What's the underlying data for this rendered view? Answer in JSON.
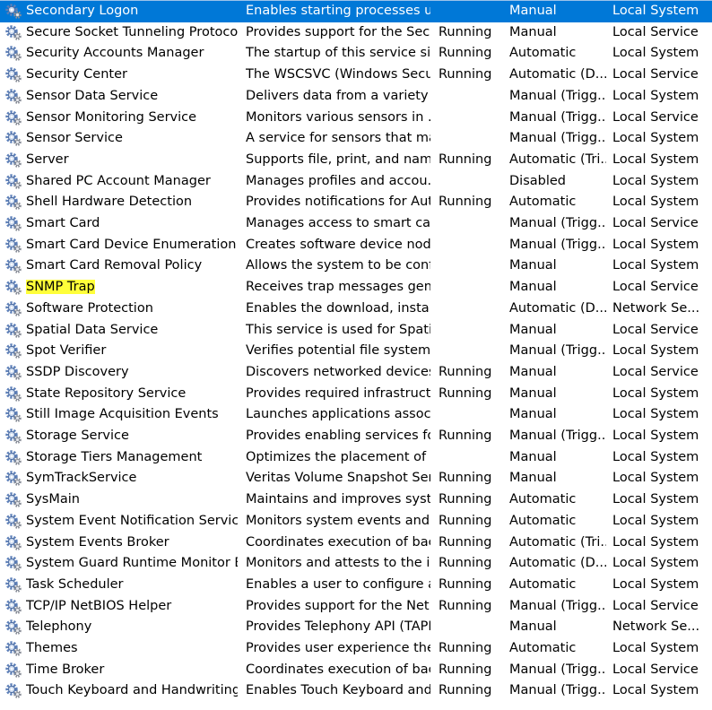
{
  "colors": {
    "selection": "#0078d7",
    "highlight": "#ffff3a",
    "gear": "#5c7fb8"
  },
  "icon": "gear-icon",
  "selected_row": 0,
  "highlighted_row": 13,
  "services": [
    {
      "name": "Secondary Logon",
      "description": "Enables starting processes u...",
      "status": "",
      "startup": "Manual",
      "logon": "Local System"
    },
    {
      "name": "Secure Socket Tunneling Protocol ...",
      "description": "Provides support for the Sec...",
      "status": "Running",
      "startup": "Manual",
      "logon": "Local Service"
    },
    {
      "name": "Security Accounts Manager",
      "description": "The startup of this service sig...",
      "status": "Running",
      "startup": "Automatic",
      "logon": "Local System"
    },
    {
      "name": "Security Center",
      "description": "The WSCSVC (Windows Secur...",
      "status": "Running",
      "startup": "Automatic (D...",
      "logon": "Local Service"
    },
    {
      "name": "Sensor Data Service",
      "description": "Delivers data from a variety o...",
      "status": "",
      "startup": "Manual (Trigg...",
      "logon": "Local System"
    },
    {
      "name": "Sensor Monitoring Service",
      "description": "Monitors various sensors in ...",
      "status": "",
      "startup": "Manual (Trigg...",
      "logon": "Local Service"
    },
    {
      "name": "Sensor Service",
      "description": "A service for sensors that ma...",
      "status": "",
      "startup": "Manual (Trigg...",
      "logon": "Local System"
    },
    {
      "name": "Server",
      "description": "Supports file, print, and nam...",
      "status": "Running",
      "startup": "Automatic (Tri...",
      "logon": "Local System"
    },
    {
      "name": "Shared PC Account Manager",
      "description": "Manages profiles and accou...",
      "status": "",
      "startup": "Disabled",
      "logon": "Local System"
    },
    {
      "name": "Shell Hardware Detection",
      "description": "Provides notifications for Aut...",
      "status": "Running",
      "startup": "Automatic",
      "logon": "Local System"
    },
    {
      "name": "Smart Card",
      "description": "Manages access to smart car...",
      "status": "",
      "startup": "Manual (Trigg...",
      "logon": "Local Service"
    },
    {
      "name": "Smart Card Device Enumeration Se...",
      "description": "Creates software device node...",
      "status": "",
      "startup": "Manual (Trigg...",
      "logon": "Local System"
    },
    {
      "name": "Smart Card Removal Policy",
      "description": "Allows the system to be confi...",
      "status": "",
      "startup": "Manual",
      "logon": "Local System"
    },
    {
      "name": "SNMP Trap",
      "description": "Receives trap messages gene...",
      "status": "",
      "startup": "Manual",
      "logon": "Local Service"
    },
    {
      "name": "Software Protection",
      "description": "Enables the download, install...",
      "status": "",
      "startup": "Automatic (D...",
      "logon": "Network Se..."
    },
    {
      "name": "Spatial Data Service",
      "description": "This service is used for Spatia...",
      "status": "",
      "startup": "Manual",
      "logon": "Local Service"
    },
    {
      "name": "Spot Verifier",
      "description": "Verifies potential file system ...",
      "status": "",
      "startup": "Manual (Trigg...",
      "logon": "Local System"
    },
    {
      "name": "SSDP Discovery",
      "description": "Discovers networked devices ...",
      "status": "Running",
      "startup": "Manual",
      "logon": "Local Service"
    },
    {
      "name": "State Repository Service",
      "description": "Provides required infrastruct...",
      "status": "Running",
      "startup": "Manual",
      "logon": "Local System"
    },
    {
      "name": "Still Image Acquisition Events",
      "description": "Launches applications associ...",
      "status": "",
      "startup": "Manual",
      "logon": "Local System"
    },
    {
      "name": "Storage Service",
      "description": "Provides enabling services fo...",
      "status": "Running",
      "startup": "Manual (Trigg...",
      "logon": "Local System"
    },
    {
      "name": "Storage Tiers Management",
      "description": "Optimizes the placement of ...",
      "status": "",
      "startup": "Manual",
      "logon": "Local System"
    },
    {
      "name": "SymTrackService",
      "description": "Veritas Volume Snapshot Ser...",
      "status": "Running",
      "startup": "Manual",
      "logon": "Local System"
    },
    {
      "name": "SysMain",
      "description": "Maintains and improves syst...",
      "status": "Running",
      "startup": "Automatic",
      "logon": "Local System"
    },
    {
      "name": "System Event Notification Service",
      "description": "Monitors system events and ...",
      "status": "Running",
      "startup": "Automatic",
      "logon": "Local System"
    },
    {
      "name": "System Events Broker",
      "description": "Coordinates execution of bac...",
      "status": "Running",
      "startup": "Automatic (Tri...",
      "logon": "Local System"
    },
    {
      "name": "System Guard Runtime Monitor Br...",
      "description": "Monitors and attests to the i...",
      "status": "Running",
      "startup": "Automatic (D...",
      "logon": "Local System"
    },
    {
      "name": "Task Scheduler",
      "description": "Enables a user to configure a...",
      "status": "Running",
      "startup": "Automatic",
      "logon": "Local System"
    },
    {
      "name": "TCP/IP NetBIOS Helper",
      "description": "Provides support for the Net...",
      "status": "Running",
      "startup": "Manual (Trigg...",
      "logon": "Local Service"
    },
    {
      "name": "Telephony",
      "description": "Provides Telephony API (TAPI)...",
      "status": "",
      "startup": "Manual",
      "logon": "Network Se..."
    },
    {
      "name": "Themes",
      "description": "Provides user experience the...",
      "status": "Running",
      "startup": "Automatic",
      "logon": "Local System"
    },
    {
      "name": "Time Broker",
      "description": "Coordinates execution of bac...",
      "status": "Running",
      "startup": "Manual (Trigg...",
      "logon": "Local Service"
    },
    {
      "name": "Touch Keyboard and Handwriting ...",
      "description": "Enables Touch Keyboard and...",
      "status": "Running",
      "startup": "Manual (Trigg...",
      "logon": "Local System"
    }
  ]
}
